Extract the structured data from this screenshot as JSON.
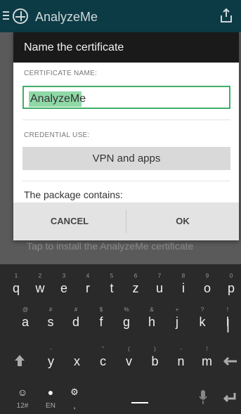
{
  "app_bar": {
    "title": "AnalyzeMe"
  },
  "background": {
    "hint": "Tap to install the AnalyzeMe certificate"
  },
  "dialog": {
    "title": "Name the certificate",
    "cert_name_label": "CERTIFICATE NAME:",
    "cert_name_value": "AnalyzeMe",
    "credential_label": "CREDENTIAL USE:",
    "credential_value": "VPN and apps",
    "package_text": "The package contains:",
    "cancel": "CANCEL",
    "ok": "OK"
  },
  "keyboard": {
    "row1": [
      {
        "main": "q",
        "sub": "1"
      },
      {
        "main": "w",
        "sub": "2"
      },
      {
        "main": "e",
        "sub": "3"
      },
      {
        "main": "r",
        "sub": "4"
      },
      {
        "main": "t",
        "sub": "5"
      },
      {
        "main": "z",
        "sub": "6"
      },
      {
        "main": "u",
        "sub": "7"
      },
      {
        "main": "i",
        "sub": "8"
      },
      {
        "main": "o",
        "sub": "9"
      },
      {
        "main": "p",
        "sub": "0"
      }
    ],
    "row2": [
      {
        "main": "a",
        "sub": "@"
      },
      {
        "main": "s",
        "sub": "#"
      },
      {
        "main": "d",
        "sub": "#"
      },
      {
        "main": "f",
        "sub": "$"
      },
      {
        "main": "g",
        "sub": "%"
      },
      {
        "main": "h",
        "sub": "&"
      },
      {
        "main": "j",
        "sub": "+"
      },
      {
        "main": "k",
        "sub": "?"
      },
      {
        "main": "l",
        "sub": "!"
      }
    ],
    "row3": [
      {
        "main": "y",
        "sub": "-"
      },
      {
        "main": "x",
        "sub": ""
      },
      {
        "main": "c",
        "sub": "\""
      },
      {
        "main": "v",
        "sub": "("
      },
      {
        "main": "b",
        "sub": ")"
      },
      {
        "main": "n",
        "sub": "-"
      },
      {
        "main": "m",
        "sub": "!"
      }
    ],
    "bottom": {
      "num_label": "12#",
      "lang_label": "EN",
      "comma": ","
    }
  }
}
